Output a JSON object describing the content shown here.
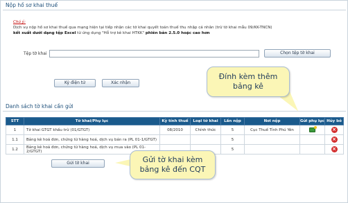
{
  "upload_section": {
    "title": "Nộp hồ sơ khai thuế",
    "note_label": "Chú ý:",
    "note_line1": "Dịch vụ nộp hồ sơ khai thuế qua mạng hiện tại tiếp nhận các tờ khai quyết toán thuế thu nhập cá nhân (trừ tờ khai mẫu 09/KK-TNCN)",
    "note_line2_pre": "dưới dạng tệp Excel",
    "note_line2_a": "độc ",
    "note_line2_bold1": "kết xuất dưới dạng tệp Excel",
    "note_line2_mid": " từ ứng dụng \"Hỗ trợ kê khai HTKK\" ",
    "note_line2_bold2": "phiên bản 2.5.0 hoặc cao hơn",
    "file_label": "Tệp tờ khai",
    "file_value": "",
    "choose_file_button": "Chọn tệp tờ khai",
    "sign_button": "Ký điện tử",
    "confirm_button": "Xác nhận"
  },
  "list_section": {
    "title": "Danh sách tờ khai cần gửi",
    "columns": [
      "STT",
      "Tờ khai/Phụ lục",
      "Kỳ tính thuế",
      "Loại tờ khai",
      "Lần nộp",
      "Nơi nộp",
      "Gửi phụ lục",
      "Hủy bỏ"
    ],
    "rows": [
      {
        "stt": "1",
        "name": "Tờ khai GTGT khấu trừ (01/GTGT)",
        "period": "08/2010",
        "type": "Chính thức",
        "times": "5",
        "place": "Cục Thuế Tỉnh Phú Yên",
        "attach": true
      },
      {
        "stt": "1.1",
        "name": "Bảng kê hoá đơn, chứng từ hàng hoá, dịch vụ bán ra (PL 01-1/GTGT)",
        "period": "",
        "type": "",
        "times": "5",
        "place": "",
        "attach": false
      },
      {
        "stt": "1.2",
        "name": "Bảng kê hoá đơn, chứng từ hàng hoá, dịch vụ mua vào (PL 01-2/GTGT)",
        "period": "",
        "type": "",
        "times": "5",
        "place": "",
        "attach": false
      }
    ],
    "send_button": "Gửi tờ khai"
  },
  "callouts": {
    "attach_line1": "Đính kèm thêm",
    "attach_line2": "bảng kê",
    "send_line1": "Gửi tờ khai kèm",
    "send_line2": "bảng kê đến CQT"
  },
  "icons": {
    "attach": "attach-appendix-icon",
    "delete": "delete-icon"
  }
}
